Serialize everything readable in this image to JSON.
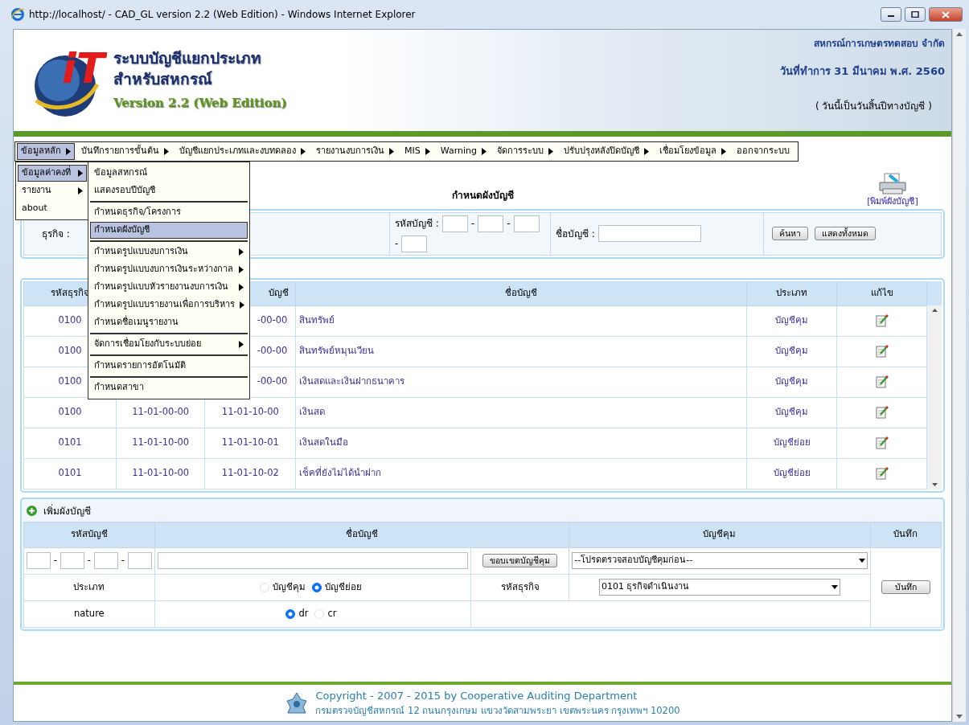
{
  "window": {
    "title": "http://localhost/ - CAD_GL version 2.2 (Web Edition) - Windows Internet Explorer"
  },
  "header": {
    "logo_text": "iT",
    "title_line_1": "ระบบบัญชีแยกประเภท",
    "title_line_2": "สำหรับสหกรณ์",
    "version": "Version 2.2 (Web Edition)",
    "org": "สหกรณ์การเกษตรทดสอบ จำกัด",
    "work_date": "วันที่ทำการ 31 มีนาคม พ.ศ. 2560",
    "note": "( วันนี้เป็นวันสิ้นปีทางบัญชี )"
  },
  "menu": [
    {
      "label": "ข้อมูลหลัก",
      "selected": true,
      "has_submenu": true
    },
    {
      "label": "บันทึกรายการขั้นต้น",
      "selected": false,
      "has_submenu": true
    },
    {
      "label": "บัญชีแยกประเภทและงบทดลอง",
      "selected": false,
      "has_submenu": true
    },
    {
      "label": "รายงานงบการเงิน",
      "selected": false,
      "has_submenu": true
    },
    {
      "label": "MIS",
      "selected": false,
      "has_submenu": true
    },
    {
      "label": "Warning",
      "selected": false,
      "has_submenu": true
    },
    {
      "label": "จัดการระบบ",
      "selected": false,
      "has_submenu": true
    },
    {
      "label": "ปรับปรุงหลังปิดบัญชี",
      "selected": false,
      "has_submenu": true
    },
    {
      "label": "เชื่อมโยงข้อมูล",
      "selected": false,
      "has_submenu": true
    },
    {
      "label": "ออกจากระบบ",
      "selected": false,
      "has_submenu": false
    }
  ],
  "submenu": [
    {
      "label": "ข้อมูลค่าคงที่",
      "selected": true,
      "has_submenu": true
    },
    {
      "label": "รายงาน",
      "selected": false,
      "has_submenu": true
    },
    {
      "label": "about",
      "selected": false,
      "has_submenu": false
    }
  ],
  "submenu_2": [
    [
      {
        "label": "ข้อมูลสหกรณ์",
        "selected": false,
        "has_submenu": false
      },
      {
        "label": "แสดงรอบปีบัญชี",
        "selected": false,
        "has_submenu": false
      }
    ],
    [
      {
        "label": "กำหนดธุรกิจ/โครงการ",
        "selected": false,
        "has_submenu": false
      },
      {
        "label": "กำหนดผังบัญชี",
        "selected": true,
        "has_submenu": false
      }
    ],
    [
      {
        "label": "กำหนดรูปแบบงบการเงิน",
        "selected": false,
        "has_submenu": true
      },
      {
        "label": "กำหนดรูปแบบงบการเงินระหว่างกาล",
        "selected": false,
        "has_submenu": true
      },
      {
        "label": "กำหนดรูปแบบหัวรายงานงบการเงิน",
        "selected": false,
        "has_submenu": true
      },
      {
        "label": "กำหนดรูปแบบรายงานเพื่อการบริหาร",
        "selected": false,
        "has_submenu": true
      },
      {
        "label": "กำหนดชื่อเมนูรายงาน",
        "selected": false,
        "has_submenu": false
      }
    ],
    [
      {
        "label": "จัดการเชื่อมโยงกับระบบย่อย",
        "selected": false,
        "has_submenu": true
      }
    ],
    [
      {
        "label": "กำหนดรายการอัตโนมัติ",
        "selected": false,
        "has_submenu": false
      }
    ],
    [
      {
        "label": "กำหนดสาขา",
        "selected": false,
        "has_submenu": false
      }
    ]
  ],
  "page_title": "กำหนดผังบัญชี",
  "print_link": "[พิมพ์ผังบัญชี]",
  "filter": {
    "business_label": "ธุรกิจ :",
    "code_label": "รหัสบัญชี :",
    "code_separators": [
      "-",
      "-",
      "-"
    ],
    "name_label": "ชื่อบัญชี :",
    "buttons": [
      "ค้นหา",
      "แสดงทั้งหมด"
    ]
  },
  "table": {
    "columns": [
      "รหัสธุรกิจ",
      null,
      "บัญชี",
      "ชื่อบัญชี",
      "ประเภท",
      "แก้ไข"
    ],
    "rows": [
      {
        "business": "0100",
        "control": null,
        "code": "-00-00",
        "code_covered": true,
        "name": "สินทรัพย์",
        "type": "บัญชีคุม"
      },
      {
        "business": "0100",
        "control": null,
        "code": "-00-00",
        "code_covered": true,
        "name": "สินทรัพย์หมุนเวียน",
        "type": "บัญชีคุม"
      },
      {
        "business": "0100",
        "control": null,
        "code": "-00-00",
        "code_covered": true,
        "name": "เงินสดและเงินฝากธนาคาร",
        "type": "บัญชีคุม"
      },
      {
        "business": "0100",
        "control": "11-01-00-00",
        "code": "11-01-10-00",
        "code_covered": false,
        "name": "เงินสด",
        "type": "บัญชีคุม"
      },
      {
        "business": "0101",
        "control": "11-01-10-00",
        "code": "11-01-10-01",
        "code_covered": false,
        "name": "เงินสดในมือ",
        "type": "บัญชีย่อย"
      },
      {
        "business": "0101",
        "control": "11-01-10-00",
        "code": "11-01-10-02",
        "code_covered": false,
        "name": "เช็คที่ยังไม่ได้นำฝาก",
        "type": "บัญชีย่อย"
      }
    ]
  },
  "add_form": {
    "title": "เพิ่มผังบัญชี",
    "columns": [
      "รหัสบัญชี",
      "ชื่อบัญชี",
      "บัญชีคุม",
      "บันทึก"
    ],
    "code_separators": [
      "-",
      "-",
      "-"
    ],
    "browse_button": "ขอบเขตบัญชีคุม",
    "control_select": "--โปรดตรวจสอบบัญชีคุมก่อน--",
    "type_label": "ประเภท",
    "type_options": [
      {
        "label": "บัญชีคุม",
        "selected": false
      },
      {
        "label": "บัญชีย่อย",
        "selected": true
      }
    ],
    "business_label": "รหัสธุรกิจ",
    "business_select": "0101 ธุรกิจดำเนินงาน",
    "save_button": "บันทึก",
    "nature_label": "nature",
    "nature_options": [
      {
        "label": "dr",
        "selected": true
      },
      {
        "label": "cr",
        "selected": false
      }
    ]
  },
  "footer": {
    "copyright": "Copyright - 2007 - 2015 by Cooperative Auditing Department",
    "address": "กรมตรวจบัญชีสหกรณ์ 12 ถนนกรุงเกษม แขวงวัดสามพระยา เขตพระนคร กรุงเทพฯ 10200"
  }
}
